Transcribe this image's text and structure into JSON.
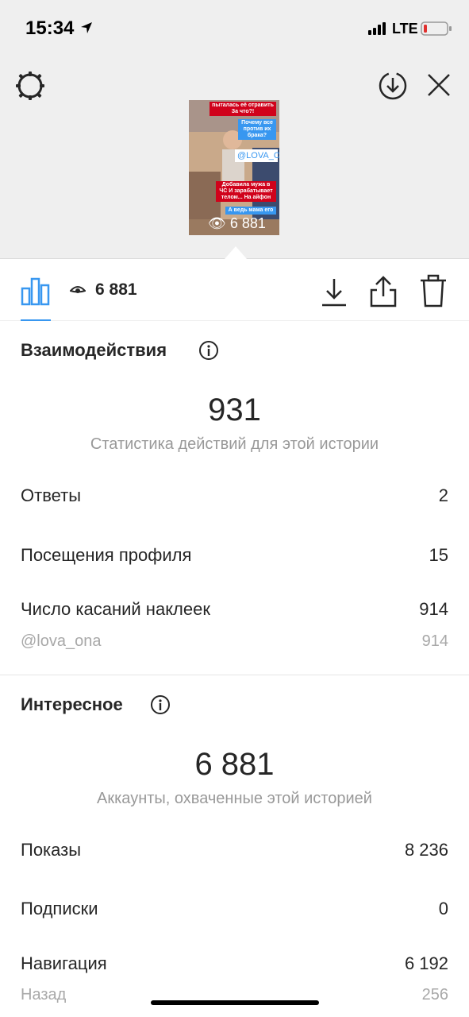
{
  "status_bar": {
    "time": "15:34",
    "network": "LTE"
  },
  "story": {
    "stickers": [
      "пыталась её отравить За что?!",
      "Почему все против их брака?",
      "@LOVA_ONA",
      "Добавила мужа в ЧС И зарабатывает телом... На айфон",
      "А ведь мама его"
    ],
    "views_overlay": "6 881"
  },
  "tabbar": {
    "views": "6 881"
  },
  "interactions": {
    "title": "Взаимодействия",
    "total": "931",
    "caption": "Статистика действий для этой истории",
    "rows": [
      {
        "label": "Ответы",
        "value": "2"
      },
      {
        "label": "Посещения профиля",
        "value": "15"
      },
      {
        "label": "Число касаний наклеек",
        "value": "914"
      }
    ],
    "sub_row": {
      "label": "@lova_ona",
      "value": "914"
    }
  },
  "discovery": {
    "title": "Интересное",
    "total": "6 881",
    "caption": "Аккаунты, охваченные этой историей",
    "rows": [
      {
        "label": "Показы",
        "value": "8 236"
      },
      {
        "label": "Подписки",
        "value": "0"
      },
      {
        "label": "Навигация",
        "value": "6 192"
      }
    ],
    "sub_row": {
      "label": "Назад",
      "value": "256"
    }
  },
  "colors": {
    "accent": "#3897f0",
    "sticker_red": "#d0021b",
    "muted": "#999999"
  }
}
